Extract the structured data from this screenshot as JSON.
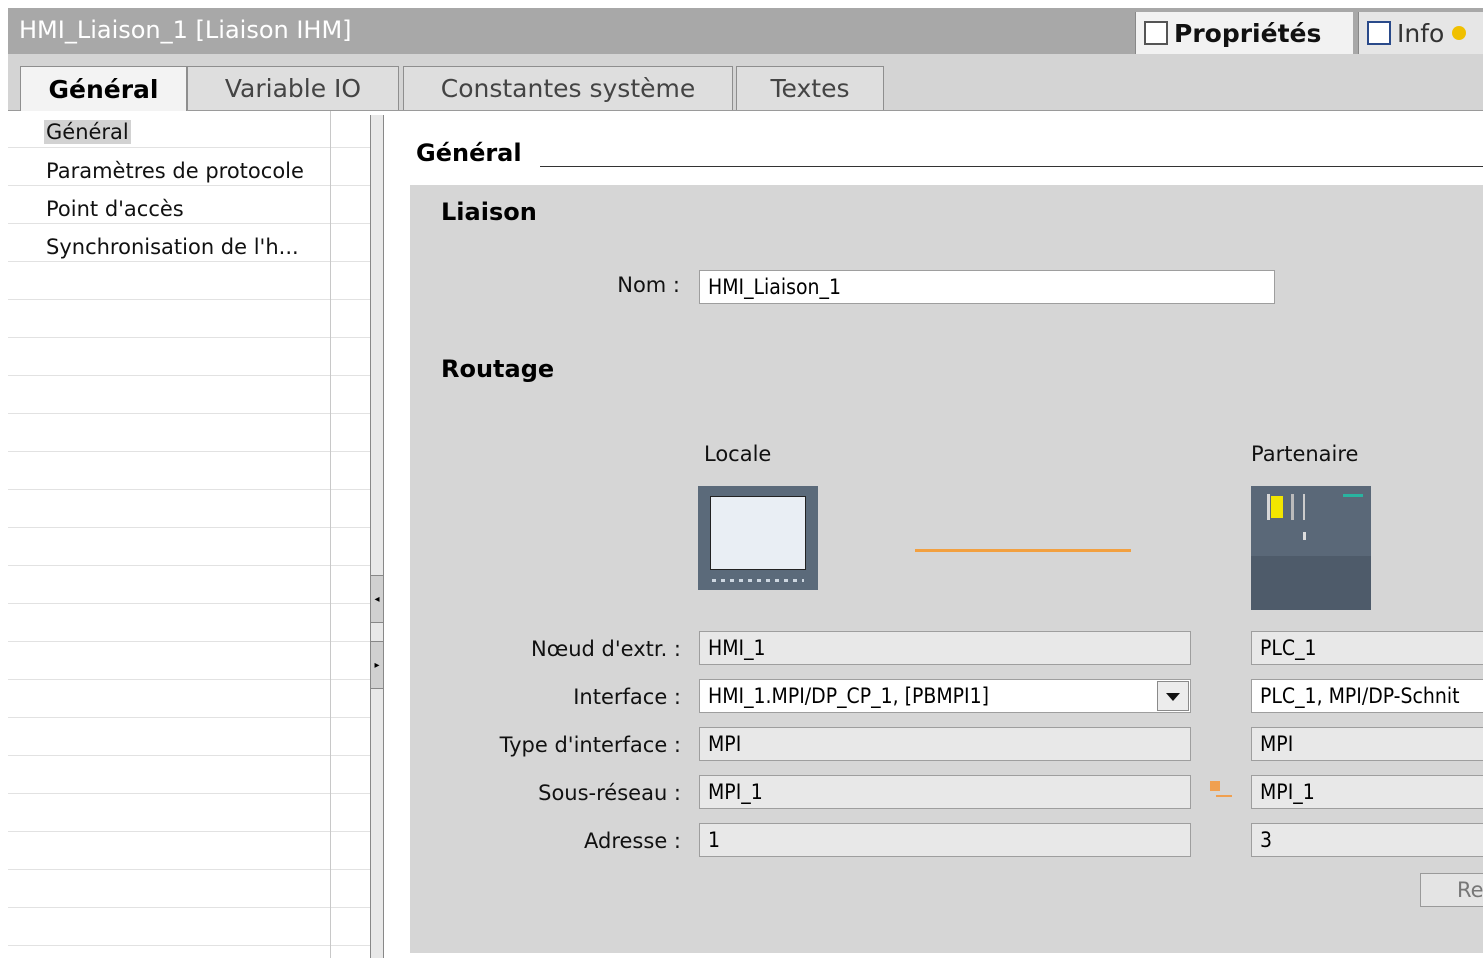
{
  "window": {
    "title": "HMI_Liaison_1 [Liaison IHM]",
    "properties_tab": "Propriétés",
    "info_tab": "Info"
  },
  "tabs": [
    "Général",
    "Variable IO",
    "Constantes système",
    "Textes"
  ],
  "nav": {
    "items": [
      "Général",
      "Paramètres de protocole",
      "Point d'accès",
      "Synchronisation de l'h..."
    ]
  },
  "content": {
    "section_title": "Général",
    "liaison": {
      "title": "Liaison",
      "name_label": "Nom :",
      "name_value": "HMI_Liaison_1"
    },
    "routage": {
      "title": "Routage",
      "local_header": "Locale",
      "partner_header": "Partenaire",
      "labels": {
        "node": "Nœud d'extr. :",
        "interface": "Interface :",
        "interface_type": "Type d'interface :",
        "subnet": "Sous-réseau :",
        "address": "Adresse :"
      },
      "local": {
        "node": "HMI_1",
        "interface": "HMI_1.MPI/DP_CP_1, [PBMPI1]",
        "interface_type": "MPI",
        "subnet": "MPI_1",
        "address": "1"
      },
      "partner": {
        "node": "PLC_1",
        "interface": "PLC_1, MPI/DP-Schnit",
        "interface_type": "MPI",
        "subnet": "MPI_1",
        "address": "3"
      },
      "button_label": "Re"
    }
  }
}
